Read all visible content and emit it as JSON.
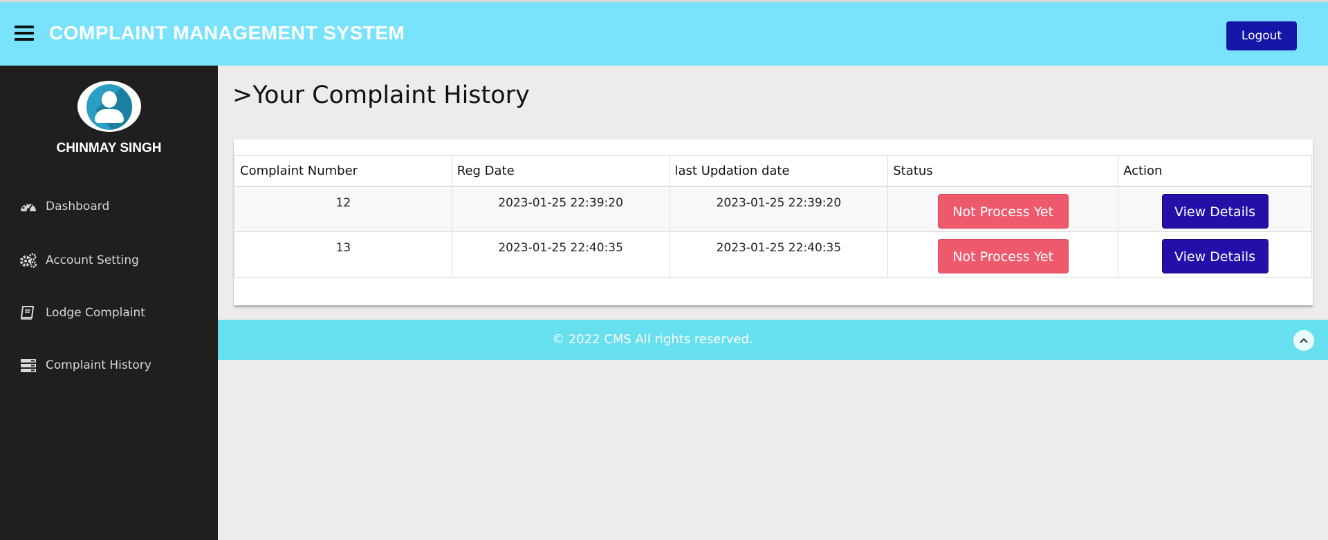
{
  "header": {
    "title": "COMPLAINT MANAGEMENT SYSTEM",
    "logout_label": "Logout"
  },
  "sidebar": {
    "user_name": "CHINMAY SINGH",
    "items": [
      {
        "label": "Dashboard",
        "icon": "dashboard-icon"
      },
      {
        "label": "Account Setting",
        "icon": "gears-icon"
      },
      {
        "label": "Lodge Complaint",
        "icon": "book-icon"
      },
      {
        "label": "Complaint History",
        "icon": "server-icon"
      }
    ]
  },
  "main": {
    "title_prefix": ">",
    "title": "Your Complaint History",
    "table": {
      "columns": [
        "Complaint Number",
        "Reg Date",
        "last Updation date",
        "Status",
        "Action"
      ],
      "rows": [
        {
          "number": "12",
          "reg_date": "2023-01-25 22:39:20",
          "updated": "2023-01-25 22:39:20",
          "status": "Not Process Yet",
          "action": "View Details"
        },
        {
          "number": "13",
          "reg_date": "2023-01-25 22:40:35",
          "updated": "2023-01-25 22:40:35",
          "status": "Not Process Yet",
          "action": "View Details"
        }
      ]
    }
  },
  "footer": {
    "text": "© 2022 CMS All rights reserved.",
    "scroll_icon": "chevron-up-icon"
  },
  "colors": {
    "header_bg": "#79e3fd",
    "sidebar_bg": "#1f1f1f",
    "logout_bg": "#1316a6",
    "status_bg": "#ee5a6c",
    "action_bg": "#2310a8",
    "footer_bg": "#66dfef"
  }
}
